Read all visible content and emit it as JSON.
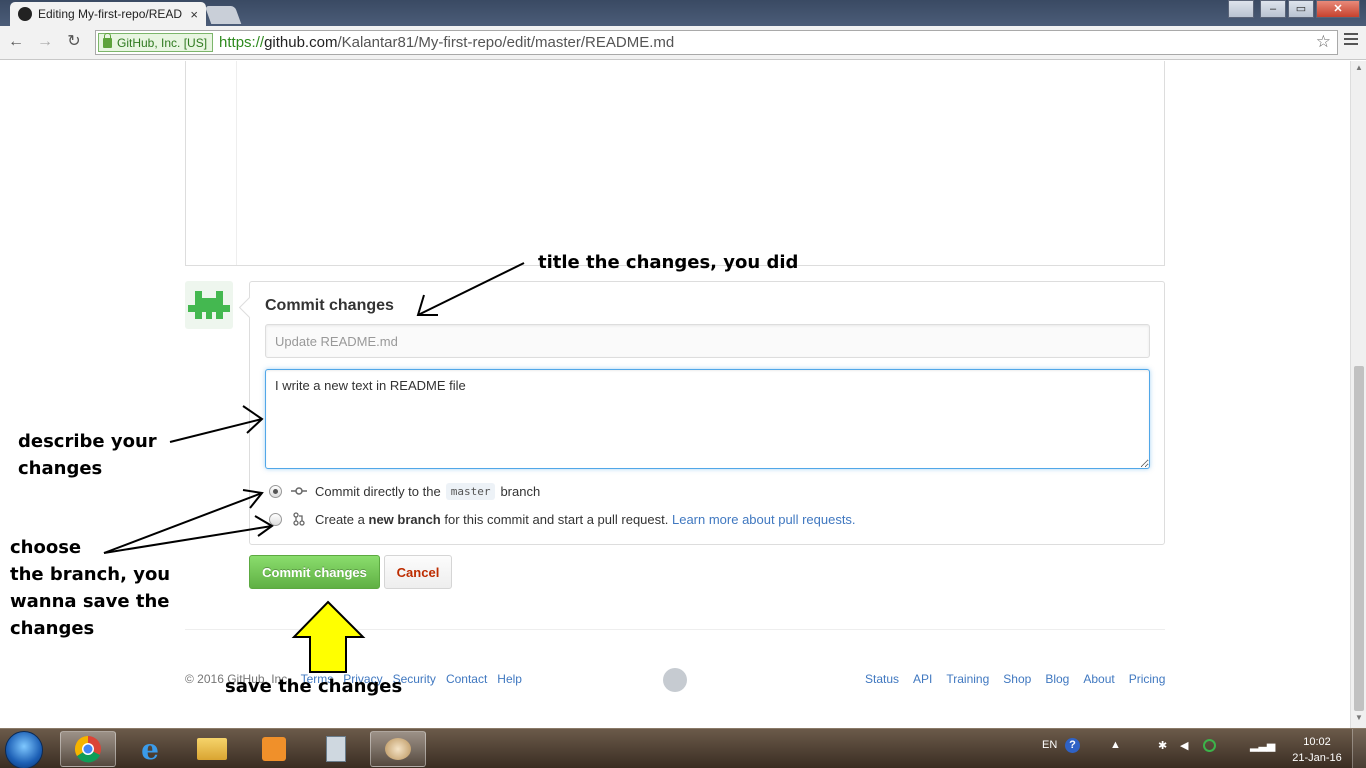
{
  "browser": {
    "tab_title": "Editing My-first-repo/READ",
    "tab_close": "×",
    "security_label": "GitHub, Inc. [US]",
    "url_scheme": "https://",
    "url_host": "github.com",
    "url_path": "/Kalantar81/My-first-repo/edit/master/README.md",
    "window_buttons": {
      "restore": "▭",
      "close": "✕"
    },
    "nav": {
      "back": "←",
      "forward": "→",
      "reload": "↻",
      "star": "☆"
    }
  },
  "commit": {
    "heading": "Commit changes",
    "summary_placeholder": "Update README.md",
    "description_value": "I write a new text in README file",
    "option_direct": {
      "prefix": "Commit directly to the",
      "branch": "master",
      "suffix": "branch",
      "selected": true
    },
    "option_new_branch": {
      "prefix": "Create a",
      "bold": "new branch",
      "suffix": "for this commit and start a pull request.",
      "link": "Learn more about pull requests.",
      "selected": false
    },
    "submit_label": "Commit changes",
    "cancel_label": "Cancel"
  },
  "footer": {
    "copyright": "© 2016 GitHub, Inc.",
    "left_links": [
      "Terms",
      "Privacy",
      "Security",
      "Contact",
      "Help"
    ],
    "right_links": [
      "Status",
      "API",
      "Training",
      "Shop",
      "Blog",
      "About",
      "Pricing"
    ]
  },
  "annotations": {
    "title_note": "title the changes, you did",
    "describe_note_1": "describe your",
    "describe_note_2": "changes",
    "branch_note_1": "choose",
    "branch_note_2": "the branch, you",
    "branch_note_3": "wanna save the",
    "branch_note_4": "changes",
    "save_note": "save the changes"
  },
  "taskbar": {
    "language": "EN",
    "time": "10:02",
    "date": "21-Jan-16"
  },
  "colors": {
    "primary_button": "#60b044",
    "danger_text": "#bd2c00",
    "link": "#4078c0",
    "focus_border": "#51a7e8",
    "arrow_fill": "#ffff00"
  }
}
